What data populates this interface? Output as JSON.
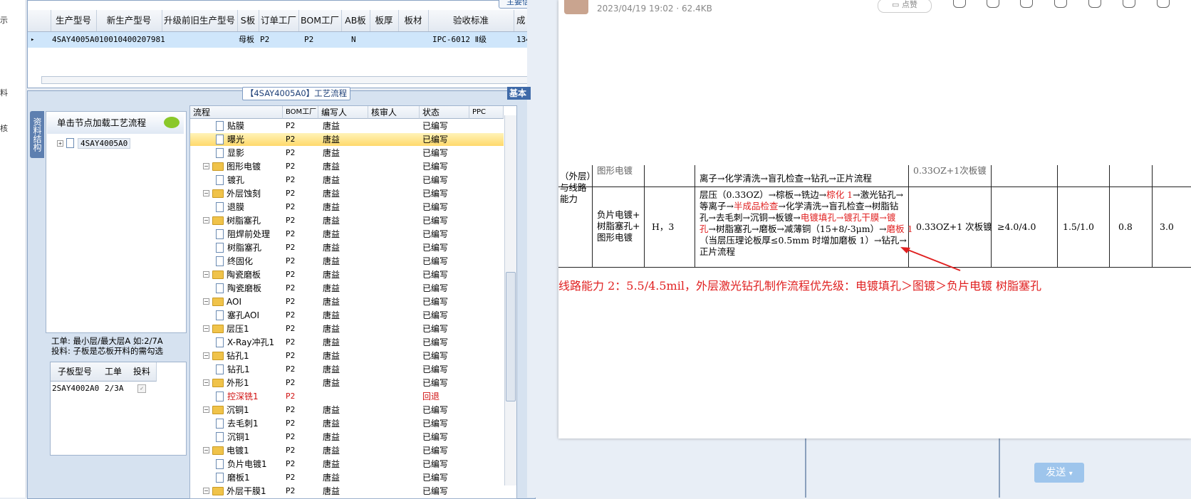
{
  "left_strip": {
    "chars": [
      "示",
      "料",
      "核"
    ]
  },
  "top_grid": {
    "main_info_tab": "主要信息",
    "headers": [
      "生产型号",
      "新生产型号",
      "升级前旧生产型号",
      "S板",
      "订单工厂",
      "BOM工厂",
      "AB板",
      "板厚",
      "板材",
      "验收标准",
      "成"
    ],
    "row": {
      "marker": "▸",
      "cells": [
        "4SAY4005A0",
        "10010400207981",
        "",
        "母板",
        "P2",
        "P2",
        "N",
        "",
        "",
        "IPC-6012 Ⅱ级",
        "134"
      ]
    }
  },
  "process_panel": {
    "title": "【4SAY4005A0】工艺流程",
    "side_tab": "资料结构",
    "tree_header": "单击节点加载工艺流程",
    "tree_node": "4SAY4005A0",
    "note_line1": "工单: 最小层/最大层A 如:2/7A",
    "note_line2": "投料: 子板是芯板开料的需勾选",
    "sub_headers": [
      "子板型号",
      "工单",
      "投料"
    ],
    "sub_row": [
      "2SAY4002A0",
      "2/3A",
      ""
    ]
  },
  "process_grid": {
    "headers": [
      "流程",
      "BOM工厂",
      "编写人",
      "核审人",
      "状态",
      "PPC"
    ],
    "rows": [
      {
        "type": "doc",
        "name": "贴膜",
        "bom": "P2",
        "writer": "唐益",
        "status": "已编写"
      },
      {
        "type": "doc",
        "name": "曝光",
        "bom": "P2",
        "writer": "唐益",
        "status": "已编写",
        "selected": true
      },
      {
        "type": "doc",
        "name": "显影",
        "bom": "P2",
        "writer": "唐益",
        "status": "已编写"
      },
      {
        "type": "folder",
        "name": "图形电镀",
        "bom": "P2",
        "writer": "唐益",
        "status": "已编写"
      },
      {
        "type": "doc",
        "name": "镀孔",
        "bom": "P2",
        "writer": "唐益",
        "status": "已编写"
      },
      {
        "type": "folder",
        "name": "外层蚀刻",
        "bom": "P2",
        "writer": "唐益",
        "status": "已编写"
      },
      {
        "type": "doc",
        "name": "退膜",
        "bom": "P2",
        "writer": "唐益",
        "status": "已编写"
      },
      {
        "type": "folder",
        "name": "树脂塞孔",
        "bom": "P2",
        "writer": "唐益",
        "status": "已编写"
      },
      {
        "type": "doc",
        "name": "阻焊前处理",
        "bom": "P2",
        "writer": "唐益",
        "status": "已编写"
      },
      {
        "type": "doc",
        "name": "树脂塞孔",
        "bom": "P2",
        "writer": "唐益",
        "status": "已编写"
      },
      {
        "type": "doc",
        "name": "终固化",
        "bom": "P2",
        "writer": "唐益",
        "status": "已编写"
      },
      {
        "type": "folder",
        "name": "陶瓷磨板",
        "bom": "P2",
        "writer": "唐益",
        "status": "已编写"
      },
      {
        "type": "doc",
        "name": "陶瓷磨板",
        "bom": "P2",
        "writer": "唐益",
        "status": "已编写"
      },
      {
        "type": "folder",
        "name": "AOI",
        "bom": "P2",
        "writer": "唐益",
        "status": "已编写"
      },
      {
        "type": "doc",
        "name": "塞孔AOI",
        "bom": "P2",
        "writer": "唐益",
        "status": "已编写"
      },
      {
        "type": "folder",
        "name": "层压1",
        "bom": "P2",
        "writer": "唐益",
        "status": "已编写"
      },
      {
        "type": "doc",
        "name": "X-Ray冲孔1",
        "bom": "P2",
        "writer": "唐益",
        "status": "已编写"
      },
      {
        "type": "folder",
        "name": "钻孔1",
        "bom": "P2",
        "writer": "唐益",
        "status": "已编写"
      },
      {
        "type": "doc",
        "name": "钻孔1",
        "bom": "P2",
        "writer": "唐益",
        "status": "已编写"
      },
      {
        "type": "folder",
        "name": "外形1",
        "bom": "P2",
        "writer": "唐益",
        "status": "已编写"
      },
      {
        "type": "doc",
        "name": "控深铣1",
        "bom": "P2",
        "writer": "",
        "status": "回退",
        "red": true
      },
      {
        "type": "folder",
        "name": "沉铜1",
        "bom": "P2",
        "writer": "唐益",
        "status": "已编写"
      },
      {
        "type": "doc",
        "name": "去毛刺1",
        "bom": "P2",
        "writer": "唐益",
        "status": "已编写"
      },
      {
        "type": "doc",
        "name": "沉铜1",
        "bom": "P2",
        "writer": "唐益",
        "status": "已编写"
      },
      {
        "type": "folder",
        "name": "电镀1",
        "bom": "P2",
        "writer": "唐益",
        "status": "已编写"
      },
      {
        "type": "doc",
        "name": "负片电镀1",
        "bom": "P2",
        "writer": "唐益",
        "status": "已编写"
      },
      {
        "type": "doc",
        "name": "磨板1",
        "bom": "P2",
        "writer": "唐益",
        "status": "已编写"
      },
      {
        "type": "folder",
        "name": "外层干膜1",
        "bom": "P2",
        "writer": "唐益",
        "status": "已编写"
      }
    ]
  },
  "right_panel": {
    "base_tab": "基本"
  },
  "viewer": {
    "date": "2023/04/19 19:02 · 62.4KB",
    "like": "点赞",
    "doc": {
      "row1_col1": "图形电镀",
      "row1_flow": "离子→化学清洗→盲孔检查→钻孔→正片流程",
      "row1_copper": "0.33OZ+1次板镀",
      "left_label": [
        "（外层）",
        "与线路",
        "能力"
      ],
      "row2_col1": [
        "负片电镀+",
        "树脂塞孔+",
        "图形电镀"
      ],
      "row2_col2": "H，3",
      "row2_flow_l1_a": "层压（0.33OZ）→棕板→铣边→",
      "row2_flow_l1_b": "棕化 1",
      "row2_flow_l1_c": "→激光钻孔→",
      "row2_flow_l2_a": "等离子→",
      "row2_flow_l2_b": "半成品检查",
      "row2_flow_l2_c": "→化学清洗→盲孔检查→树脂钻",
      "row2_flow_l3_a": "孔→去毛刺→沉铜→板镀→",
      "row2_flow_l3_b": "电镀填孔→镀孔干膜→镀",
      "row2_flow_l4_a": "孔",
      "row2_flow_l4_b": "→树脂塞孔→磨板→减薄铜（15+8/-3μm）→",
      "row2_flow_l4_c": "磨板 1",
      "row2_flow_l5": "（当层压理论板厚≤0.5mm 时增加磨板 1）→钻孔→",
      "row2_flow_l6": "正片流程",
      "row2_copper": "0.33OZ+1 次板镀",
      "row2_ratio": "≥4.0/4.0",
      "row2_c5": "1.5/1.0",
      "row2_c6": "0.8",
      "row2_c7": "3.0",
      "red_line": "线路能力 2：5.5/4.5mil，外层激光钻孔制作流程优先级：电镀填孔＞图镀＞负片电镀 树脂塞孔"
    }
  },
  "send_button": "发送"
}
